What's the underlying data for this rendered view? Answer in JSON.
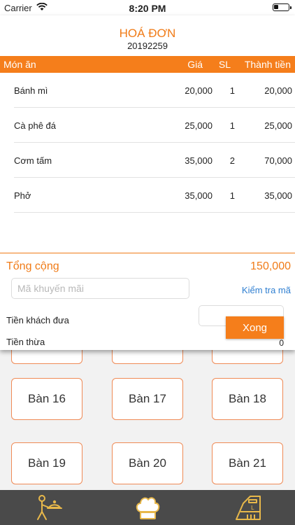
{
  "status": {
    "carrier": "Carrier",
    "time": "8:20 PM"
  },
  "invoice": {
    "title": "HOÁ ĐƠN",
    "number": "20192259",
    "columns": {
      "name": "Món ăn",
      "price": "Giá",
      "qty": "SL",
      "total": "Thành tiền"
    },
    "items": [
      {
        "name": "Bánh mì",
        "price": "20,000",
        "qty": "1",
        "total": "20,000"
      },
      {
        "name": "Cà phê đá",
        "price": "25,000",
        "qty": "1",
        "total": "25,000"
      },
      {
        "name": "Cơm tấm",
        "price": "35,000",
        "qty": "2",
        "total": "70,000"
      },
      {
        "name": "Phở",
        "price": "35,000",
        "qty": "1",
        "total": "35,000"
      }
    ],
    "total_label": "Tổng cộng",
    "total_value": "150,000",
    "promo_placeholder": "Mã khuyến mãi",
    "check_code": "Kiểm tra mã",
    "paid_label": "Tiền khách đưa",
    "done_label": "Xong",
    "change_label": "Tiền thừa",
    "change_value": "0"
  },
  "tables": [
    "Bàn 16",
    "Bàn 17",
    "Bàn 18",
    "Bàn 19",
    "Bàn 20",
    "Bàn 21"
  ],
  "tabs": [
    {
      "icon": "waiter-icon"
    },
    {
      "icon": "chef-hat-icon"
    },
    {
      "icon": "cash-register-icon"
    }
  ],
  "colors": {
    "accent": "#f57e1b",
    "link": "#2f7fd1",
    "tabbar": "#4a4a4a",
    "icon": "#e8b84a"
  }
}
